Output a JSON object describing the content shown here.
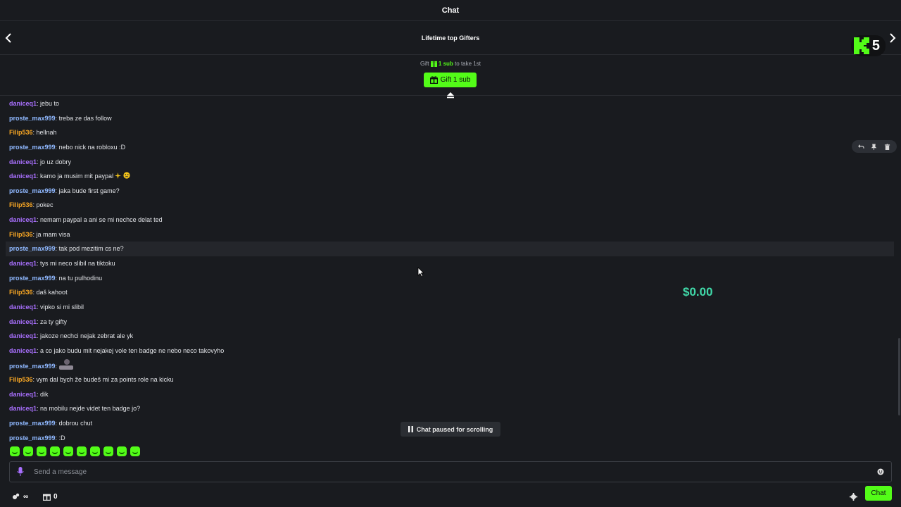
{
  "header": {
    "title": "Chat"
  },
  "gifters": {
    "title": "Lifetime top Gifters",
    "kick_count": "5",
    "note_prefix": "Gift",
    "note_highlight": "1 sub",
    "note_suffix": "to take 1st",
    "gift_button_label": "Gift 1 sub"
  },
  "colors": {
    "accent": "#53fc18",
    "user_purple": "#a970ff",
    "user_blue": "#8fb8ff",
    "user_orange": "#f5a524",
    "amount": "#40d8a8"
  },
  "messages": [
    {
      "user": "daniceq1",
      "color": "#a970ff",
      "text": "jebu to"
    },
    {
      "user": "proste_max999",
      "color": "#8fb8ff",
      "text": "treba ze das follow"
    },
    {
      "user": "Filip536",
      "color": "#f5a524",
      "text": "hellnah"
    },
    {
      "user": "proste_max999",
      "color": "#8fb8ff",
      "text": "nebo nick na robloxu :D"
    },
    {
      "user": "daniceq1",
      "color": "#a970ff",
      "text": "jo uz dobry"
    },
    {
      "user": "daniceq1",
      "color": "#a970ff",
      "text": "kamo ja musim mit paypal",
      "emotes": [
        "sparkle-emoji",
        "crying-face-emoji"
      ]
    },
    {
      "user": "proste_max999",
      "color": "#8fb8ff",
      "text": "jaka bude first game?"
    },
    {
      "user": "Filip536",
      "color": "#f5a524",
      "text": "pokec"
    },
    {
      "user": "daniceq1",
      "color": "#a970ff",
      "text": "nemam paypal a ani se mi nechce delat ted"
    },
    {
      "user": "Filip536",
      "color": "#f5a524",
      "text": "ja mam visa"
    },
    {
      "user": "proste_max999",
      "color": "#8fb8ff",
      "text": "tak pod mezitim cs ne?",
      "hover": true
    },
    {
      "user": "daniceq1",
      "color": "#a970ff",
      "text": "tys mi neco slibil na tiktoku"
    },
    {
      "user": "proste_max999",
      "color": "#8fb8ff",
      "text": "na tu pulhodinu"
    },
    {
      "user": "Filip536",
      "color": "#f5a524",
      "text": "daš kahoot"
    },
    {
      "user": "daniceq1",
      "color": "#a970ff",
      "text": "vipko si mi slibil"
    },
    {
      "user": "daniceq1",
      "color": "#a970ff",
      "text": "za ty gifty"
    },
    {
      "user": "daniceq1",
      "color": "#a970ff",
      "text": "jakoze nechci nejak zebrat ale yk"
    },
    {
      "user": "daniceq1",
      "color": "#a970ff",
      "text": "a co jako budu mit nejakej vole ten badge ne nebo neco takovyho"
    },
    {
      "user": "proste_max999",
      "color": "#8fb8ff",
      "text": "",
      "emotes": [
        "person-emote"
      ]
    },
    {
      "user": "Filip536",
      "color": "#f5a524",
      "text": "vym dal bych že budeš mi za points role na kicku"
    },
    {
      "user": "daniceq1",
      "color": "#a970ff",
      "text": "dik"
    },
    {
      "user": "daniceq1",
      "color": "#a970ff",
      "text": "na mobilu nejde videt ten badge jo?"
    },
    {
      "user": "proste_max999",
      "color": "#8fb8ff",
      "text": "dobrou chut"
    },
    {
      "user": "proste_max999",
      "color": "#8fb8ff",
      "text": ":D"
    }
  ],
  "overlay_amount": "$0.00",
  "paused_label": "Chat paused for scrolling",
  "input": {
    "placeholder": "Send a message"
  },
  "bottom": {
    "points_value": "∞",
    "gift_count": "0",
    "chat_button_label": "Chat"
  },
  "emote_bar": [
    "emote-smile",
    "emote-grin",
    "emote-wink",
    "emote-laugh",
    "emote-box",
    "emote-happy",
    "emote-clown",
    "emote-clown2",
    "emote-smirk",
    "emote-cool"
  ]
}
